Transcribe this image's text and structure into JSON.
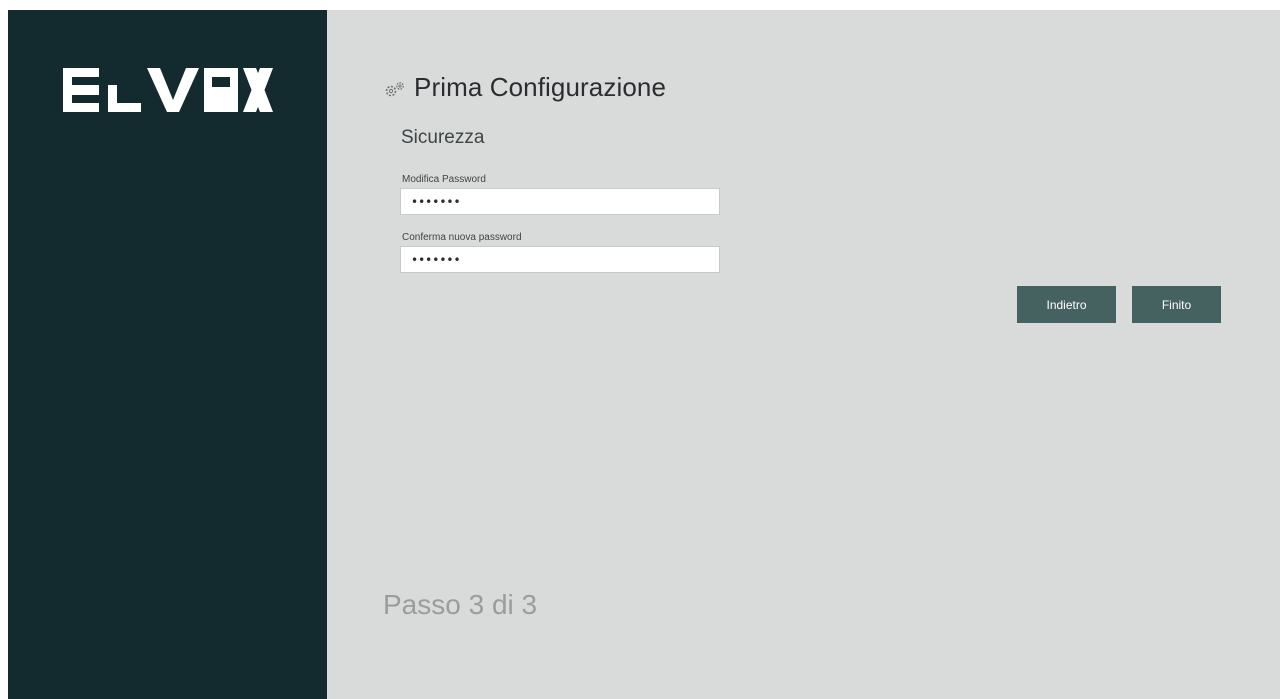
{
  "brand": {
    "logo_text": "ELVOX",
    "sidebar_color": "#132b2e"
  },
  "header": {
    "title": "Prima Configurazione",
    "icon": "gears-icon"
  },
  "section": {
    "title": "Sicurezza"
  },
  "form": {
    "password": {
      "label": "Modifica Password",
      "value": "•••••••"
    },
    "confirm_password": {
      "label": "Conferma nuova password",
      "value": "•••••••"
    }
  },
  "actions": {
    "back_label": "Indietro",
    "done_label": "Finito",
    "button_color": "#456261"
  },
  "footer": {
    "step_text": "Passo 3 di 3"
  }
}
